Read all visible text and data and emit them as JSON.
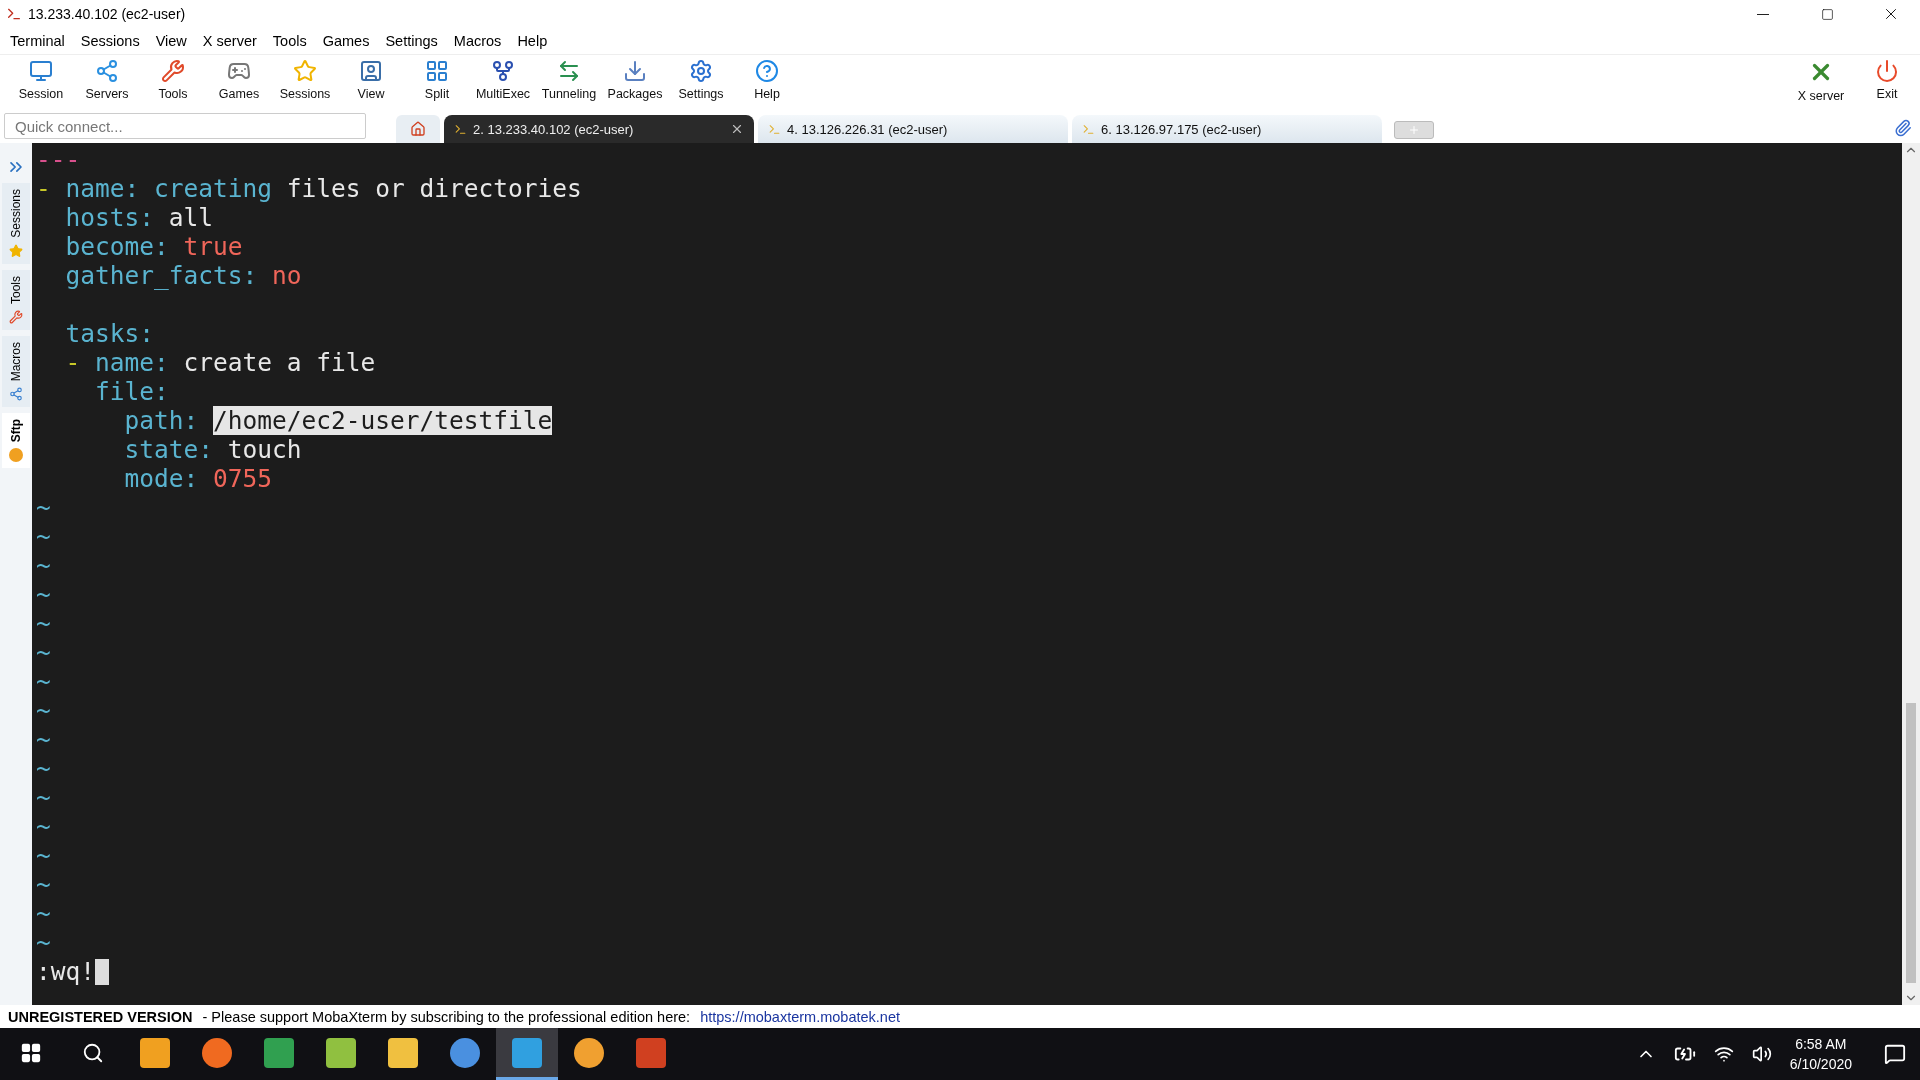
{
  "window": {
    "title": "13.233.40.102 (ec2-user)"
  },
  "menu": [
    "Terminal",
    "Sessions",
    "View",
    "X server",
    "Tools",
    "Games",
    "Settings",
    "Macros",
    "Help"
  ],
  "toolbar": [
    "Session",
    "Servers",
    "Tools",
    "Games",
    "Sessions",
    "View",
    "Split",
    "MultiExec",
    "Tunneling",
    "Packages",
    "Settings",
    "Help"
  ],
  "toolbar_right": [
    "X server",
    "Exit"
  ],
  "quick_connect": {
    "placeholder": "Quick connect..."
  },
  "tabs": [
    {
      "label": "2. 13.233.40.102 (ec2-user)",
      "selected": true
    },
    {
      "label": "4. 13.126.226.31 (ec2-user)",
      "selected": false
    },
    {
      "label": "6. 13.126.97.175 (ec2-user)",
      "selected": false
    }
  ],
  "side_tabs": [
    {
      "label": "Sessions",
      "selected": false
    },
    {
      "label": "Tools",
      "selected": false
    },
    {
      "label": "Macros",
      "selected": false
    },
    {
      "label": "Sftp",
      "selected": true
    }
  ],
  "terminal": {
    "lines": [
      {
        "kind": "code",
        "segments": [
          {
            "text": "---",
            "kind": "marker"
          }
        ]
      },
      {
        "kind": "code",
        "segments": [
          {
            "text": "- ",
            "kind": "dash"
          },
          {
            "text": "name: creating ",
            "kind": "key"
          },
          {
            "text": "files or directories",
            "kind": "plain"
          }
        ]
      },
      {
        "kind": "code",
        "segments": [
          {
            "text": "  hosts: ",
            "kind": "key"
          },
          {
            "text": "all",
            "kind": "plain"
          }
        ]
      },
      {
        "kind": "code",
        "segments": [
          {
            "text": "  become: ",
            "kind": "key"
          },
          {
            "text": "true",
            "kind": "value"
          }
        ]
      },
      {
        "kind": "code",
        "segments": [
          {
            "text": "  gather_facts: ",
            "kind": "key"
          },
          {
            "text": "no",
            "kind": "value"
          }
        ]
      },
      {
        "kind": "blank"
      },
      {
        "kind": "code",
        "segments": [
          {
            "text": "  tasks:",
            "kind": "key"
          }
        ]
      },
      {
        "kind": "code",
        "segments": [
          {
            "text": "  - ",
            "kind": "dash"
          },
          {
            "text": "name: ",
            "kind": "key"
          },
          {
            "text": "create a file",
            "kind": "plain"
          }
        ]
      },
      {
        "kind": "code",
        "segments": [
          {
            "text": "    file:",
            "kind": "key"
          }
        ]
      },
      {
        "kind": "code",
        "segments": [
          {
            "text": "      path: ",
            "kind": "key"
          },
          {
            "text": "/home/ec2-user/testfile",
            "kind": "selected"
          }
        ]
      },
      {
        "kind": "code",
        "segments": [
          {
            "text": "      state: ",
            "kind": "key"
          },
          {
            "text": "touch",
            "kind": "plain"
          }
        ]
      },
      {
        "kind": "code",
        "segments": [
          {
            "text": "      mode: ",
            "kind": "key"
          },
          {
            "text": "0755",
            "kind": "value"
          }
        ]
      },
      {
        "kind": "tilde",
        "text": "~"
      },
      {
        "kind": "tilde",
        "text": "~"
      },
      {
        "kind": "tilde",
        "text": "~"
      },
      {
        "kind": "tilde",
        "text": "~"
      },
      {
        "kind": "tilde",
        "text": "~"
      },
      {
        "kind": "tilde",
        "text": "~"
      },
      {
        "kind": "tilde",
        "text": "~"
      },
      {
        "kind": "tilde",
        "text": "~"
      },
      {
        "kind": "tilde",
        "text": "~"
      },
      {
        "kind": "tilde",
        "text": "~"
      },
      {
        "kind": "tilde",
        "text": "~"
      },
      {
        "kind": "tilde",
        "text": "~"
      },
      {
        "kind": "tilde",
        "text": "~"
      },
      {
        "kind": "tilde",
        "text": "~"
      },
      {
        "kind": "tilde",
        "text": "~"
      },
      {
        "kind": "tilde",
        "text": "~"
      },
      {
        "kind": "command",
        "text": ":wq!"
      }
    ]
  },
  "status_bar": {
    "edition": "UNREGISTERED VERSION",
    "message": "-  Please support MobaXterm by subscribing to the professional edition here:",
    "link": "https://mobaxterm.mobatek.net"
  },
  "taskbar": {
    "apps": [
      {
        "selected": false
      },
      {
        "selected": false
      },
      {
        "selected": false
      },
      {
        "selected": false
      },
      {
        "selected": false
      },
      {
        "selected": false
      },
      {
        "selected": true
      },
      {
        "selected": false
      },
      {
        "selected": false
      }
    ],
    "time": "6:58 AM",
    "date": "6/10/2020"
  }
}
